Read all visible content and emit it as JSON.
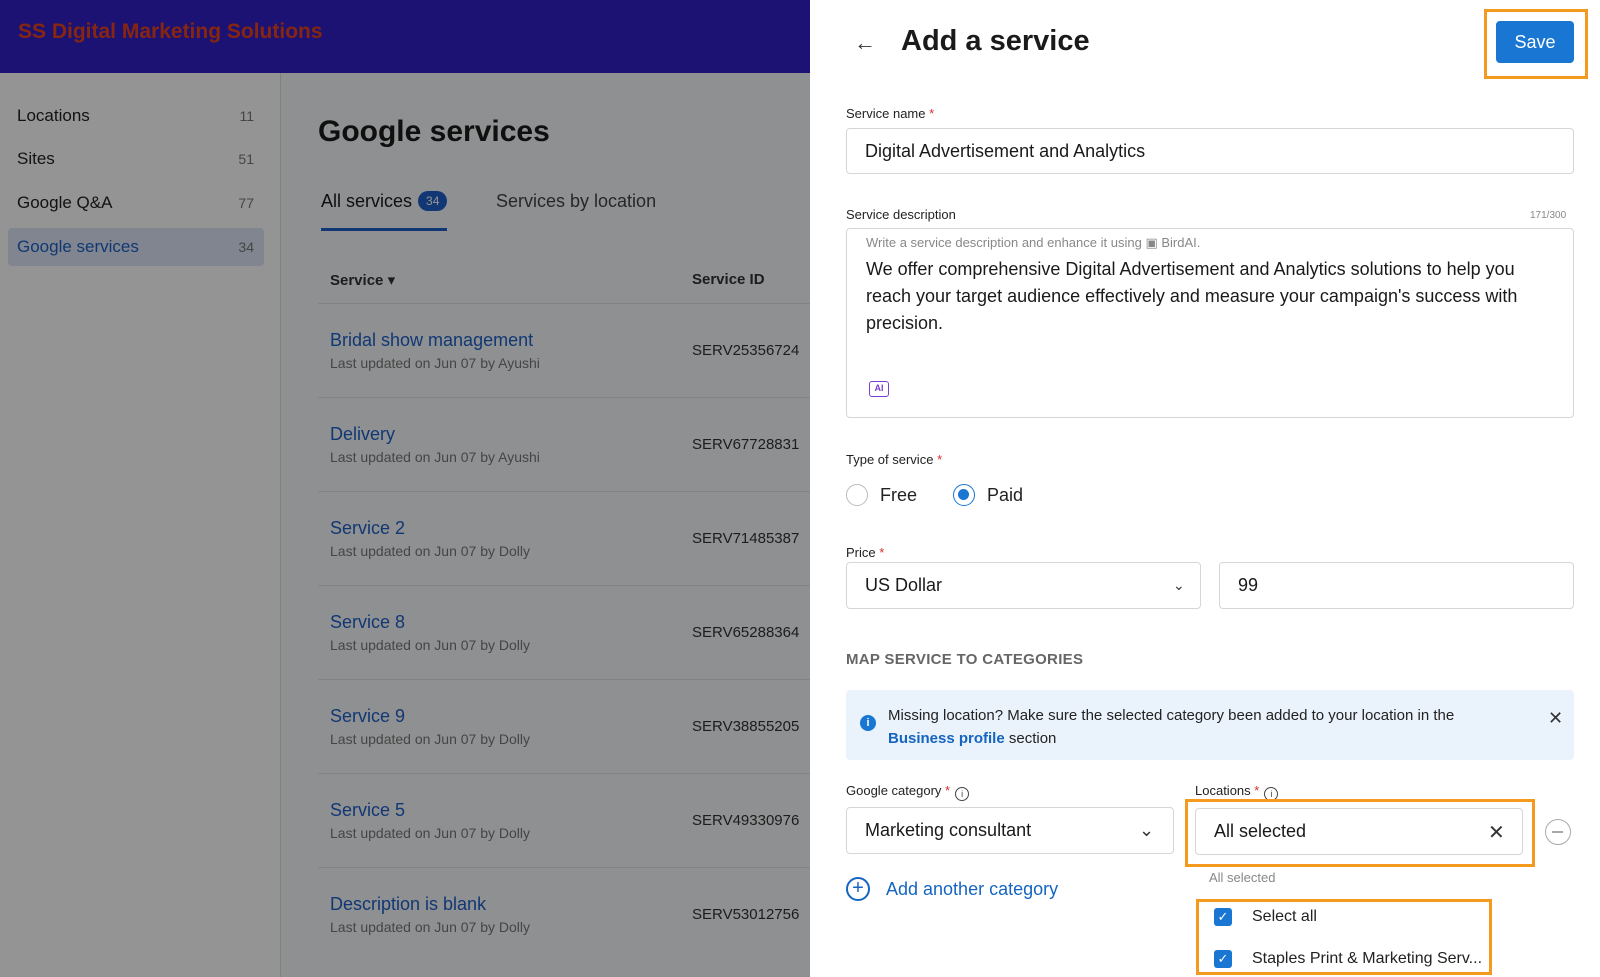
{
  "app": {
    "brand": "SS Digital Marketing Solutions"
  },
  "sidebar": {
    "items": [
      {
        "label": "Locations",
        "count": "11"
      },
      {
        "label": "Sites",
        "count": "51"
      },
      {
        "label": "Google Q&A",
        "count": "77"
      },
      {
        "label": "Google services",
        "count": "34"
      }
    ]
  },
  "main": {
    "title": "Google services",
    "tabs": [
      {
        "label": "All services",
        "badge": "34"
      },
      {
        "label": "Services by location"
      }
    ],
    "columns": {
      "service": "Service",
      "service_id": "Service ID"
    },
    "rows": [
      {
        "name": "Bridal show management",
        "meta": "Last updated on Jun 07 by Ayushi",
        "id": "SERV25356724"
      },
      {
        "name": "Delivery",
        "meta": "Last updated on Jun 07 by Ayushi",
        "id": "SERV67728831"
      },
      {
        "name": "Service 2",
        "meta": "Last updated on Jun 07 by Dolly",
        "id": "SERV71485387"
      },
      {
        "name": "Service 8",
        "meta": "Last updated on Jun 07 by Dolly",
        "id": "SERV65288364"
      },
      {
        "name": "Service 9",
        "meta": "Last updated on Jun 07 by Dolly",
        "id": "SERV38855205"
      },
      {
        "name": "Service 5",
        "meta": "Last updated on Jun 07 by Dolly",
        "id": "SERV49330976"
      },
      {
        "name": "Description is blank",
        "meta": "Last updated on Jun 07 by Dolly",
        "id": "SERV53012756"
      }
    ]
  },
  "drawer": {
    "title": "Add a service",
    "save_label": "Save",
    "service_name": {
      "label": "Service name",
      "value": "Digital Advertisement and Analytics"
    },
    "description": {
      "label": "Service description",
      "char_count": "171/300",
      "hint_prefix": "Write a service description and enhance it using",
      "hint_suffix": "BirdAI.",
      "value": "We offer comprehensive Digital Advertisement and Analytics solutions to help you reach your target audience effectively and measure your campaign's success with precision.",
      "ai_label": "AI"
    },
    "type_of_service": {
      "label": "Type of service",
      "options": [
        "Free",
        "Paid"
      ],
      "selected": "Paid"
    },
    "price": {
      "label": "Price",
      "currency": "US Dollar",
      "amount": "99"
    },
    "section_title": "MAP SERVICE TO CATEGORIES",
    "banner": {
      "text_before": "Missing location? Make sure the selected category been added to your location in the",
      "link": "Business profile",
      "text_after": "section"
    },
    "google_category": {
      "label": "Google category",
      "value": "Marketing consultant"
    },
    "locations": {
      "label": "Locations",
      "value": "All selected",
      "dropdown_caption": "All selected",
      "options": [
        "Select all",
        "Staples Print & Marketing Serv..."
      ]
    },
    "add_category_label": "Add another category"
  },
  "colors": {
    "brand_bar": "#2f1fc9",
    "accent": "#1976d2",
    "highlight": "#f39a1f",
    "required": "#d32f2f"
  }
}
